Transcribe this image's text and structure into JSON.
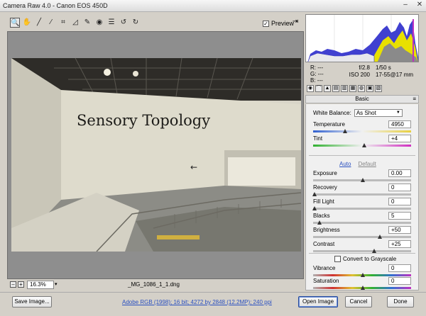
{
  "window": {
    "title": "Camera Raw 4.0  -  Canon EOS 450D",
    "minimize": "–",
    "close": "✕"
  },
  "toolbar": {
    "tools": [
      "zoom-tool",
      "hand-tool",
      "white-balance-tool",
      "color-sampler-tool",
      "crop-tool",
      "straighten-tool",
      "retouch-tool",
      "red-eye-tool",
      "preferences",
      "rotate-left",
      "rotate-right"
    ],
    "preview_label": "Preview",
    "preview_checked": true
  },
  "image": {
    "sign_text": "Sensory Topology"
  },
  "zoom": {
    "minus": "–",
    "plus": "+",
    "value": "16.3%"
  },
  "filename": "_MG_1086_1_1.dng",
  "readout": {
    "r": "R:  ---",
    "g": "G:  ---",
    "b": "B:  ---",
    "aperture": "f/2.8",
    "shutter": "1/50 s",
    "iso": "ISO 200",
    "lens": "17-55@17 mm"
  },
  "panel": {
    "title": "Basic",
    "white_balance_label": "White Balance:",
    "white_balance_value": "As Shot",
    "auto_label": "Auto",
    "default_label": "Default",
    "grayscale_label": "Convert to Grayscale",
    "sliders": {
      "temperature": {
        "label": "Temperature",
        "value": "4950",
        "fraction": 0.32
      },
      "tint": {
        "label": "Tint",
        "value": "+4",
        "fraction": 0.52
      },
      "exposure": {
        "label": "Exposure",
        "value": "0.00",
        "fraction": 0.5
      },
      "recovery": {
        "label": "Recovery",
        "value": "0",
        "fraction": 0.0
      },
      "fill_light": {
        "label": "Fill Light",
        "value": "0",
        "fraction": 0.0
      },
      "blacks": {
        "label": "Blacks",
        "value": "5",
        "fraction": 0.05
      },
      "brightness": {
        "label": "Brightness",
        "value": "+50",
        "fraction": 0.68
      },
      "contrast": {
        "label": "Contrast",
        "value": "+25",
        "fraction": 0.62
      },
      "vibrance": {
        "label": "Vibrance",
        "value": "0",
        "fraction": 0.5
      },
      "saturation": {
        "label": "Saturation",
        "value": "0",
        "fraction": 0.5
      }
    }
  },
  "buttons": {
    "save": "Save Image...",
    "workflow": "Adobe RGB (1998); 16 bit; 4272 by 2848 (12.2MP); 240 ppi",
    "open": "Open Image",
    "cancel": "Cancel",
    "done": "Done"
  }
}
